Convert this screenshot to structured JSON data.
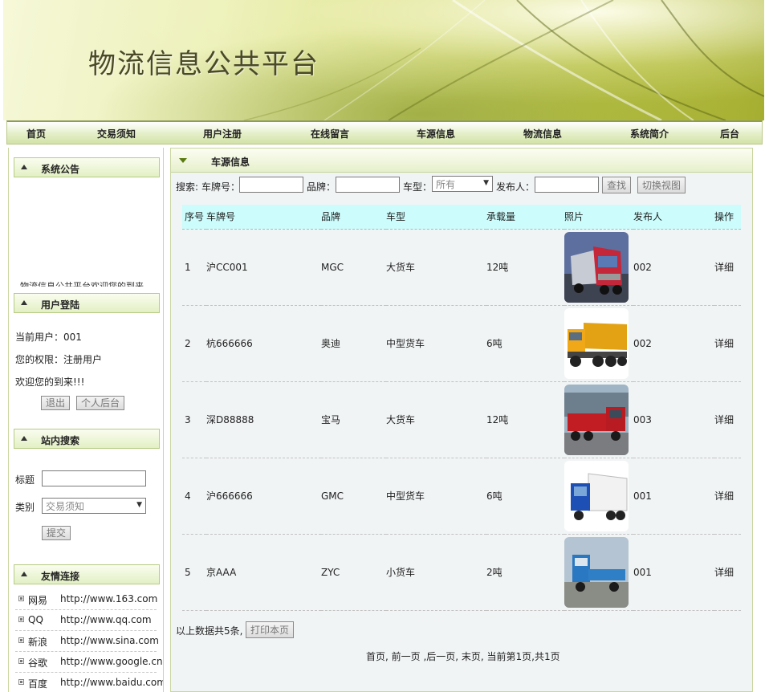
{
  "banner": {
    "title": "物流信息公共平台"
  },
  "nav": [
    "首页",
    "交易须知",
    "用户注册",
    "在线留言",
    "车源信息",
    "物流信息",
    "系统简介",
    "后台"
  ],
  "sidebar": {
    "notice_title": "系统公告",
    "notice_text": "物流信息公共平台欢迎您的到来",
    "login_title": "用户登陆",
    "current_user": "当前用户：001",
    "permission": "您的权限：注册用户",
    "welcome": "欢迎您的到来!!!",
    "logout_btn": "退出",
    "personal_btn": "个人后台",
    "search_title": "站内搜索",
    "search_title_label": "标题",
    "search_title_value": "",
    "search_category_label": "类别",
    "search_category_value": "交易须知",
    "submit_btn": "提交",
    "links_title": "友情连接",
    "links": [
      {
        "name": "网易",
        "url": "http://www.163.com"
      },
      {
        "name": "QQ",
        "url": "http://www.qq.com"
      },
      {
        "name": "新浪",
        "url": "http://www.sina.com"
      },
      {
        "name": "谷歌",
        "url": "http://www.google.cn"
      },
      {
        "name": "百度",
        "url": "http://www.baidu.com"
      }
    ]
  },
  "main": {
    "title": "车源信息",
    "search": {
      "label": "搜索:",
      "plate_label": "车牌号：",
      "plate_value": "",
      "brand_label": "品牌：",
      "brand_value": "",
      "type_label": "车型：",
      "type_value": "所有",
      "publisher_label": "发布人：",
      "publisher_value": "",
      "find_btn": "查找",
      "switch_btn": "切换视图"
    },
    "columns": [
      "序号",
      "车牌号",
      "品牌",
      "车型",
      "承载量",
      "照片",
      "发布人",
      "操作"
    ],
    "rows": [
      {
        "no": "1",
        "plate": "沪CC001",
        "brand": "MGC",
        "type": "大货车",
        "load": "12吨",
        "photo": "red-tractor-truck",
        "publisher": "002",
        "action": "详细"
      },
      {
        "no": "2",
        "plate": "杭666666",
        "brand": "奥迪",
        "type": "中型货车",
        "load": "6吨",
        "photo": "orange-dump-truck",
        "publisher": "002",
        "action": "详细"
      },
      {
        "no": "3",
        "plate": "深D88888",
        "brand": "宝马",
        "type": "大货车",
        "load": "12吨",
        "photo": "red-cargo-truck",
        "publisher": "003",
        "action": "详细"
      },
      {
        "no": "4",
        "plate": "沪666666",
        "brand": "GMC",
        "type": "中型货车",
        "load": "6吨",
        "photo": "blue-box-truck",
        "publisher": "001",
        "action": "详细"
      },
      {
        "no": "5",
        "plate": "京AAA",
        "brand": "ZYC",
        "type": "小货车",
        "load": "2吨",
        "photo": "blue-light-truck",
        "publisher": "001",
        "action": "详细"
      }
    ],
    "summary": "以上数据共5条,",
    "print_btn": "打印本页",
    "pager": "首页, 前一页 ,后一页, 末页, 当前第1页,共1页"
  }
}
